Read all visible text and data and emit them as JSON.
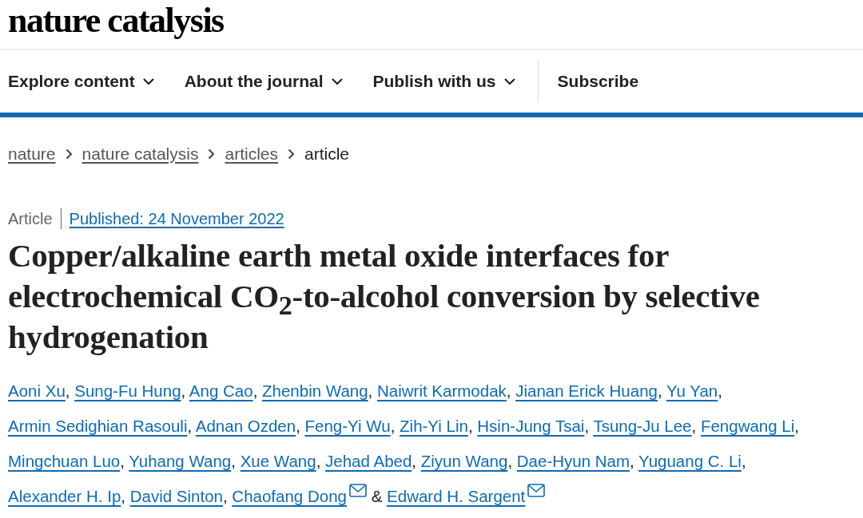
{
  "logo": "nature catalysis",
  "nav": [
    {
      "label": "Explore content",
      "dropdown": true
    },
    {
      "label": "About the journal",
      "dropdown": true
    },
    {
      "label": "Publish with us",
      "dropdown": true
    },
    {
      "label": "Subscribe",
      "dropdown": false
    }
  ],
  "breadcrumbs": [
    {
      "label": "nature",
      "link": true
    },
    {
      "label": "nature catalysis",
      "link": true
    },
    {
      "label": "articles",
      "link": true
    },
    {
      "label": "article",
      "link": false
    }
  ],
  "article_type": "Article",
  "published": "Published: 24 November 2022",
  "title": "Copper/alkaline earth metal oxide interfaces for electrochemical CO$_{2}$-to-alcohol conversion by selective hydrogenation",
  "authors": [
    {
      "name": "Aoni Xu",
      "email": false,
      "after": ","
    },
    {
      "name": "Sung-Fu Hung",
      "email": false,
      "after": ","
    },
    {
      "name": "Ang Cao",
      "email": false,
      "after": ","
    },
    {
      "name": "Zhenbin Wang",
      "email": false,
      "after": ","
    },
    {
      "name": "Naiwrit Karmodak",
      "email": false,
      "after": ","
    },
    {
      "name": "Jianan Erick Huang",
      "email": false,
      "after": ","
    },
    {
      "name": "Yu Yan",
      "email": false,
      "after": ","
    },
    {
      "name": "Armin Sedighian Rasouli",
      "email": false,
      "after": ","
    },
    {
      "name": "Adnan Ozden",
      "email": false,
      "after": ","
    },
    {
      "name": "Feng-Yi Wu",
      "email": false,
      "after": ","
    },
    {
      "name": "Zih-Yi Lin",
      "email": false,
      "after": ","
    },
    {
      "name": "Hsin-Jung Tsai",
      "email": false,
      "after": ","
    },
    {
      "name": "Tsung-Ju Lee",
      "email": false,
      "after": ","
    },
    {
      "name": "Fengwang Li",
      "email": false,
      "after": ","
    },
    {
      "name": "Mingchuan Luo",
      "email": false,
      "after": ","
    },
    {
      "name": "Yuhang Wang",
      "email": false,
      "after": ","
    },
    {
      "name": "Xue Wang",
      "email": false,
      "after": ","
    },
    {
      "name": "Jehad Abed",
      "email": false,
      "after": ","
    },
    {
      "name": "Ziyun Wang",
      "email": false,
      "after": ","
    },
    {
      "name": "Dae-Hyun Nam",
      "email": false,
      "after": ","
    },
    {
      "name": "Yuguang C. Li",
      "email": false,
      "after": ","
    },
    {
      "name": "Alexander H. Ip",
      "email": false,
      "after": ","
    },
    {
      "name": "David Sinton",
      "email": false,
      "after": ","
    },
    {
      "name": "Chaofang Dong",
      "email": true,
      "after": "&"
    },
    {
      "name": "Edward H. Sargent",
      "email": true
    }
  ]
}
